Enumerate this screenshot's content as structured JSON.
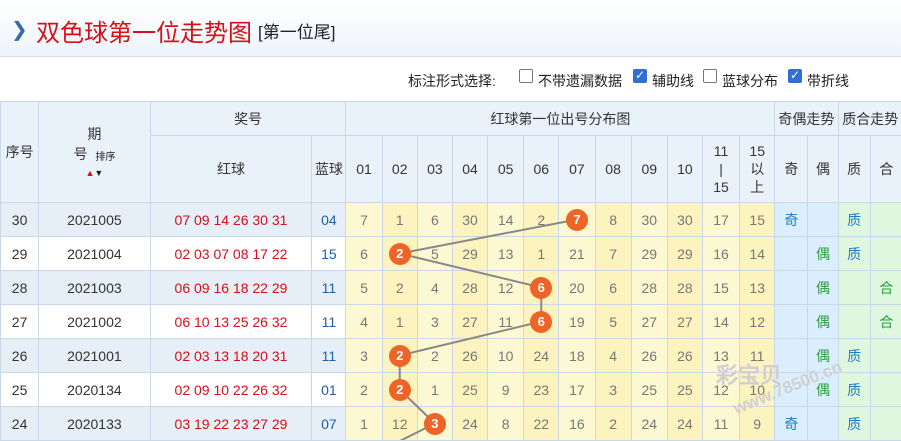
{
  "title": "双色球第一位走势图",
  "subtitle": "[第一位尾]",
  "options": {
    "label": "标注形式选择:",
    "items": [
      {
        "text": "不带遗漏数据",
        "checked": false
      },
      {
        "text": "辅助线",
        "checked": true
      },
      {
        "text": "蓝球分布",
        "checked": false
      },
      {
        "text": "带折线",
        "checked": true
      }
    ]
  },
  "headers": {
    "seq": "序号",
    "period_a": "期",
    "period_b": "号",
    "sort": "排序",
    "prize": "奖号",
    "red": "红球",
    "blue": "蓝球",
    "dist": "红球第一位出号分布图",
    "cols": [
      "01",
      "02",
      "03",
      "04",
      "05",
      "06",
      "07",
      "08",
      "09",
      "10"
    ],
    "col11": [
      "11",
      "|",
      "15"
    ],
    "col12": [
      "15",
      "以",
      "上"
    ],
    "oe": "奇偶走势",
    "odd": "奇",
    "even": "偶",
    "pc": "质合走势",
    "prime": "质",
    "comp": "合"
  },
  "rows": [
    {
      "seq": "30",
      "period": "2021005",
      "red": "07 09 14 26 30 31",
      "blue": "04",
      "dist": [
        "7",
        "1",
        "6",
        "30",
        "14",
        "2",
        "7",
        "8",
        "30",
        "30",
        "17",
        "15"
      ],
      "hit": 6,
      "odd": "奇",
      "even": "",
      "prime": "质",
      "comp": ""
    },
    {
      "seq": "29",
      "period": "2021004",
      "red": "02 03 07 08 17 22",
      "blue": "15",
      "dist": [
        "6",
        "2",
        "5",
        "29",
        "13",
        "1",
        "21",
        "7",
        "29",
        "29",
        "16",
        "14"
      ],
      "hit": 1,
      "odd": "",
      "even": "偶",
      "prime": "质",
      "comp": ""
    },
    {
      "seq": "28",
      "period": "2021003",
      "red": "06 09 16 18 22 29",
      "blue": "11",
      "dist": [
        "5",
        "2",
        "4",
        "28",
        "12",
        "6",
        "20",
        "6",
        "28",
        "28",
        "15",
        "13"
      ],
      "hit": 5,
      "odd": "",
      "even": "偶",
      "prime": "",
      "comp": "合"
    },
    {
      "seq": "27",
      "period": "2021002",
      "red": "06 10 13 25 26 32",
      "blue": "11",
      "dist": [
        "4",
        "1",
        "3",
        "27",
        "11",
        "6",
        "19",
        "5",
        "27",
        "27",
        "14",
        "12"
      ],
      "hit": 5,
      "odd": "",
      "even": "偶",
      "prime": "",
      "comp": "合"
    },
    {
      "seq": "26",
      "period": "2021001",
      "red": "02 03 13 18 20 31",
      "blue": "11",
      "dist": [
        "3",
        "2",
        "2",
        "26",
        "10",
        "24",
        "18",
        "4",
        "26",
        "26",
        "13",
        "11"
      ],
      "hit": 1,
      "odd": "",
      "even": "偶",
      "prime": "质",
      "comp": ""
    },
    {
      "seq": "25",
      "period": "2020134",
      "red": "02 09 10 22 26 32",
      "blue": "01",
      "dist": [
        "2",
        "2",
        "1",
        "25",
        "9",
        "23",
        "17",
        "3",
        "25",
        "25",
        "12",
        "10"
      ],
      "hit": 1,
      "odd": "",
      "even": "偶",
      "prime": "质",
      "comp": ""
    },
    {
      "seq": "24",
      "period": "2020133",
      "red": "03 19 22 23 27 29",
      "blue": "07",
      "dist": [
        "1",
        "12",
        "3",
        "24",
        "8",
        "22",
        "16",
        "2",
        "24",
        "24",
        "11",
        "9"
      ],
      "hit": 2,
      "odd": "奇",
      "even": "",
      "prime": "质",
      "comp": ""
    }
  ],
  "watermark": {
    "brand": "彩宝贝",
    "site": "www.78500.cn"
  }
}
